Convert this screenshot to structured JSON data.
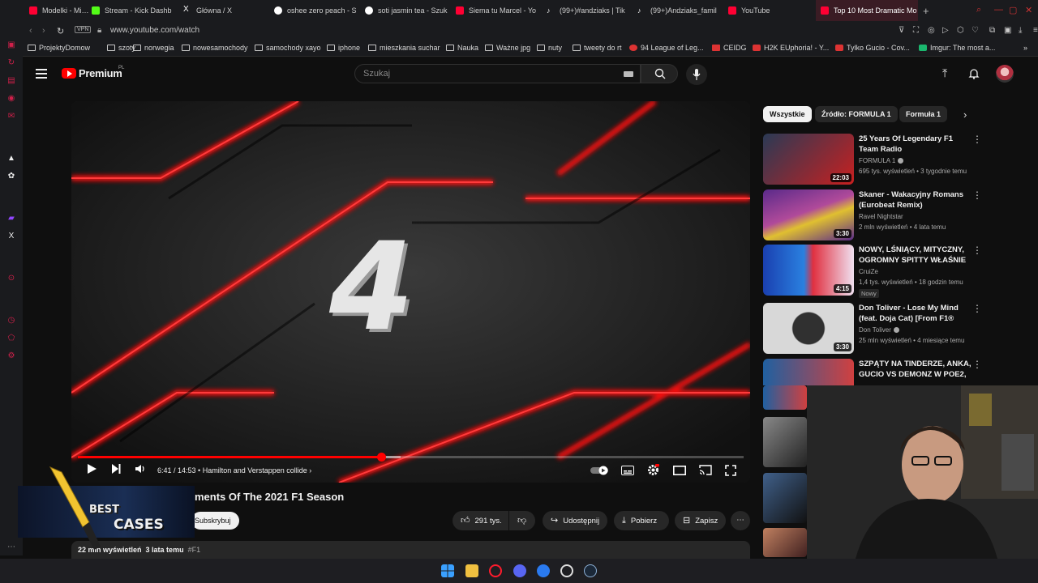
{
  "browser": {
    "tabs": [
      {
        "label": "Modelki - Miss Dior D",
        "icon_color": "#ff0033"
      },
      {
        "label": "Stream - Kick Dashb",
        "icon_color": "#53fc18"
      },
      {
        "label": "Główna / X",
        "icon_color": "#ffffff"
      },
      {
        "label": "oshee zero peach - S",
        "icon_color": "#ffffff"
      },
      {
        "label": "soti jasmin tea - Szuk",
        "icon_color": "#ffffff"
      },
      {
        "label": "Siema tu Marcel - Yo",
        "icon_color": "#ff0033"
      },
      {
        "label": "(99+)#andziaks | Tik",
        "icon_color": "#ffffff"
      },
      {
        "label": "(99+)Andziaks_famil",
        "icon_color": "#ffffff"
      },
      {
        "label": "YouTube",
        "icon_color": "#ff0033"
      },
      {
        "label": "Top 10 Most Dramatic Mo",
        "icon_color": "#ff0033"
      }
    ],
    "new_tab": "+",
    "vpn_badge": "VPN",
    "url": "www.youtube.com/watch",
    "bookmarks": [
      "ProjektyDomow",
      "szoty",
      "norwegia",
      "nowesamochody",
      "samochody xayo",
      "iphone",
      "mieszkania suchar",
      "Nauka",
      "Ważne jpg",
      "nuty",
      "tweety do rt",
      "94 League of Leg...",
      "CEIDG",
      "H2K EUphoria! - Y...",
      "Tylko Gucio - Cov...",
      "Imgur: The most a..."
    ]
  },
  "youtube": {
    "logo_text": "Premium",
    "logo_region": "PL",
    "search_placeholder": "Szukaj",
    "player": {
      "overlay_number": "4",
      "time": "6:41 / 14:53",
      "chapter": "Hamilton and Verstappen collide",
      "progress_fraction": 0.455,
      "buffer_fraction": 0.485
    },
    "video": {
      "title_visible": "ments Of The 2021 F1 Season",
      "subscribe_label": "Subskrybuj",
      "likes": "291 tys.",
      "share": "Udostępnij",
      "download": "Pobierz",
      "save": "Zapisz",
      "views": "22 mln wyświetleń",
      "age": "3 lata temu",
      "tag": "#F1"
    },
    "promo": {
      "line1": "BEST",
      "line2": "CASES"
    },
    "chips": [
      "Wszystkie",
      "Źródło: FORMULA 1",
      "Formuła 1"
    ],
    "recommendations": [
      {
        "title": "25 Years Of Legendary F1 Team Radio",
        "channel": "FORMULA 1",
        "verified": true,
        "meta": "695 tys. wyświetleń • 3 tygodnie temu",
        "duration": "22:03",
        "badge": "",
        "thumb_colors": [
          "#2a3a55",
          "#c82020"
        ]
      },
      {
        "title": "Skaner - Wakacyjny Romans (Eurobeat Remix)",
        "channel": "Ravel Nightstar",
        "verified": false,
        "meta": "2 mln wyświetleń • 4 lata temu",
        "duration": "3:30",
        "badge": "",
        "thumb_colors": [
          "#5a2a8a",
          "#e0c030"
        ]
      },
      {
        "title": "NOWY, LŚNIĄCY, MITYCZNY, OGROMNY SPITTY WŁAŚNIE ...",
        "channel": "CruiZe",
        "verified": false,
        "meta": "1,4 tys. wyświetleń • 18 godzin temu",
        "duration": "4:15",
        "badge": "Nowy",
        "thumb_colors": [
          "#1a40b0",
          "#e03040"
        ]
      },
      {
        "title": "Don Toliver - Lose My Mind (feat. Doja Cat) [From F1® The...",
        "channel": "Don Toliver",
        "verified": true,
        "meta": "25 mln wyświetleń • 4 miesiące temu",
        "duration": "3:30",
        "badge": "",
        "thumb_colors": [
          "#d8d8d8",
          "#303030"
        ]
      },
      {
        "title": "SZPĄTY NA TINDERZE, ANKA, GUCIO VS DEMONZ W POE2, ...",
        "channel": "",
        "verified": false,
        "meta": "",
        "duration": "",
        "badge": "",
        "thumb_colors": [
          "#2060a0",
          "#d04040"
        ]
      }
    ]
  }
}
